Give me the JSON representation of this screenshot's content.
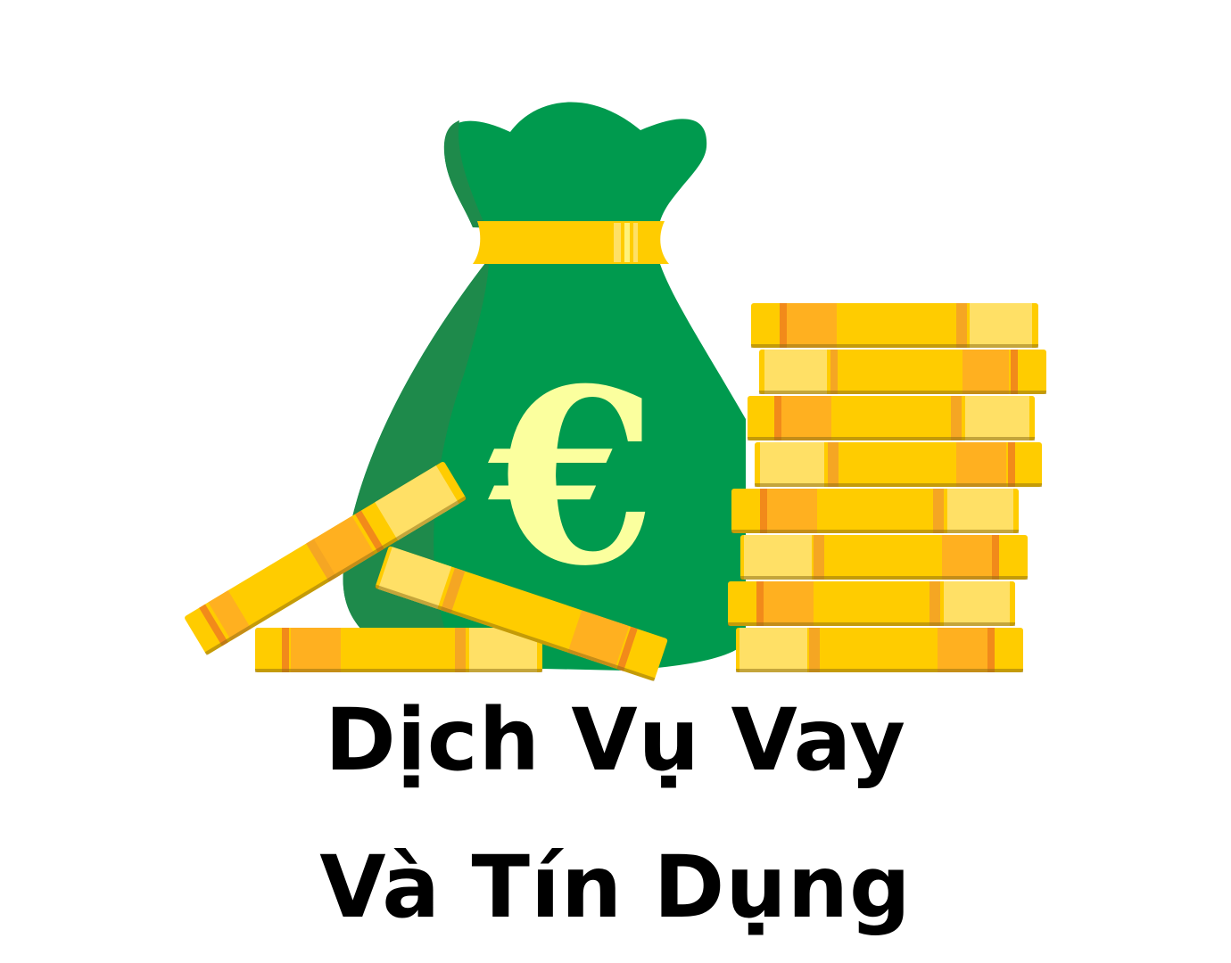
{
  "illustration": {
    "bag_icon": "money-bag-icon",
    "currency_symbol": "€",
    "coin_icon": "gold-coin-icon",
    "colors": {
      "bag_green": "#009a4e",
      "bag_shadow": "#1e8a4b",
      "gold": "#ffcc00",
      "gold_light": "#ffe066",
      "gold_dark": "#f5a623",
      "gold_stripe": "#f28a1a",
      "euro_fill": "#fbff9e"
    }
  },
  "title": {
    "line1": "Dịch Vụ Vay",
    "line2": "Và Tín Dụng"
  }
}
